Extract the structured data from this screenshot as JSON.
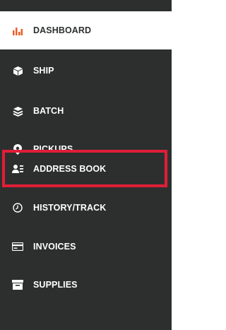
{
  "sidebar": {
    "items": [
      {
        "label": "DASHBOARD",
        "icon": "bar-chart-icon",
        "active": true
      },
      {
        "label": "SHIP",
        "icon": "box-icon"
      },
      {
        "label": "BATCH",
        "icon": "layers-icon"
      },
      {
        "label": "PICKUPS",
        "icon": "map-pin-icon"
      },
      {
        "label": "ADDRESS BOOK",
        "icon": "contacts-icon",
        "highlighted": true
      },
      {
        "label": "HISTORY/TRACK",
        "icon": "clock-icon"
      },
      {
        "label": "INVOICES",
        "icon": "credit-card-icon"
      },
      {
        "label": "SUPPLIES",
        "icon": "supplies-box-icon"
      }
    ],
    "colors": {
      "background": "#2d2f2f",
      "active_background": "#ffffff",
      "accent": "#e85d2a",
      "highlight_border": "#e01e37"
    }
  }
}
